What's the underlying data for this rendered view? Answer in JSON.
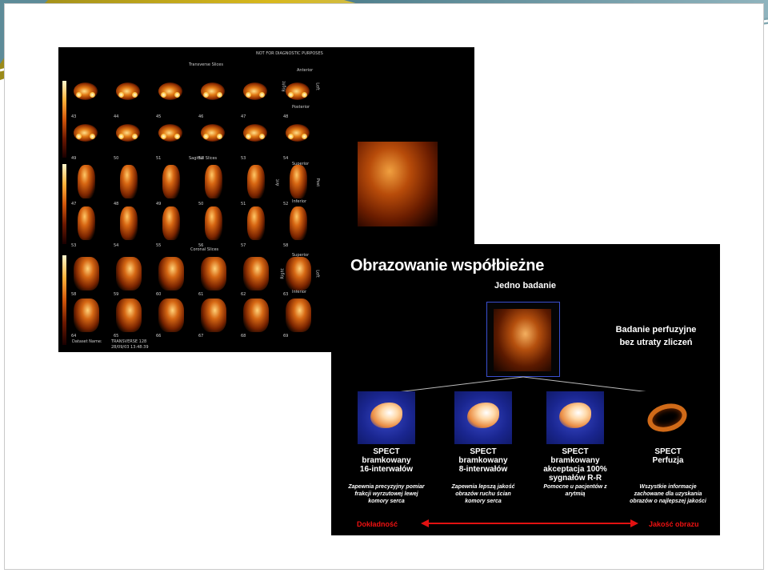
{
  "slices_panel": {
    "header_warning": "NOT FOR DIAGNOSTIC PURPOSES",
    "transverse_title": "Transverse Slices",
    "sagittal_title": "Sagittal Slices",
    "coronal_title": "Coronal Slices",
    "orientation": {
      "anterior": "Anterior",
      "posterior": "Posterior",
      "right": "Right",
      "left": "Left",
      "superior": "Superior",
      "inferior": "Inferior",
      "ant": "Ant",
      "post": "Post"
    },
    "transverse_rows": [
      [
        "43",
        "44",
        "45",
        "46",
        "47",
        "48"
      ],
      [
        "49",
        "50",
        "51",
        "52",
        "53",
        "54"
      ]
    ],
    "sagittal_rows": [
      [
        "47",
        "48",
        "49",
        "50",
        "51",
        "52"
      ],
      [
        "53",
        "54",
        "55",
        "56",
        "57",
        "58"
      ]
    ],
    "coronal_rows": [
      [
        "58",
        "59",
        "60",
        "61",
        "62",
        "63"
      ],
      [
        "64",
        "65",
        "66",
        "67",
        "68",
        "69"
      ]
    ],
    "dataset_label": "Dataset Name:",
    "dataset_value": "TRANSVERSE 128",
    "dataset_timestamp": "28/09/03 13:48:39"
  },
  "concurrent_panel": {
    "title": "Obrazowanie współbieżne",
    "single_study": "Jedno badanie",
    "perfusion_note_line1": "Badanie perfuzyjne",
    "perfusion_note_line2": "bez utraty zliczeń",
    "modes": [
      {
        "name_lines": [
          "SPECT",
          "bramkowany",
          "16-interwałów"
        ],
        "desc_lines": [
          "Zapewnia precyzyjny pomiar",
          "frakcji wyrzutowej lewej",
          "komory serca"
        ]
      },
      {
        "name_lines": [
          "SPECT",
          "bramkowany",
          "8-interwałów"
        ],
        "desc_lines": [
          "Zapewnia lepszą jakość",
          "obrazów ruchu ścian",
          "komory serca"
        ]
      },
      {
        "name_lines": [
          "SPECT",
          "bramkowany",
          "akceptacja 100%",
          "sygnałów R-R"
        ],
        "desc_lines": [
          "Pomocne u pacjentów z",
          "arytmią"
        ]
      },
      {
        "name_lines": [
          "SPECT",
          "Perfuzja"
        ],
        "desc_lines": [
          "Wszystkie informacje",
          "zachowane dla uzyskania",
          "obrazów o najlepszej jakości"
        ]
      }
    ],
    "axis_left": "Dokładność",
    "axis_right": "Jakość obrazu"
  },
  "colors": {
    "accent_red": "#e11111",
    "frame_blue": "#3a4fd0",
    "header_teal": "#6f9aa6",
    "header_gold": "#d6b21c"
  }
}
